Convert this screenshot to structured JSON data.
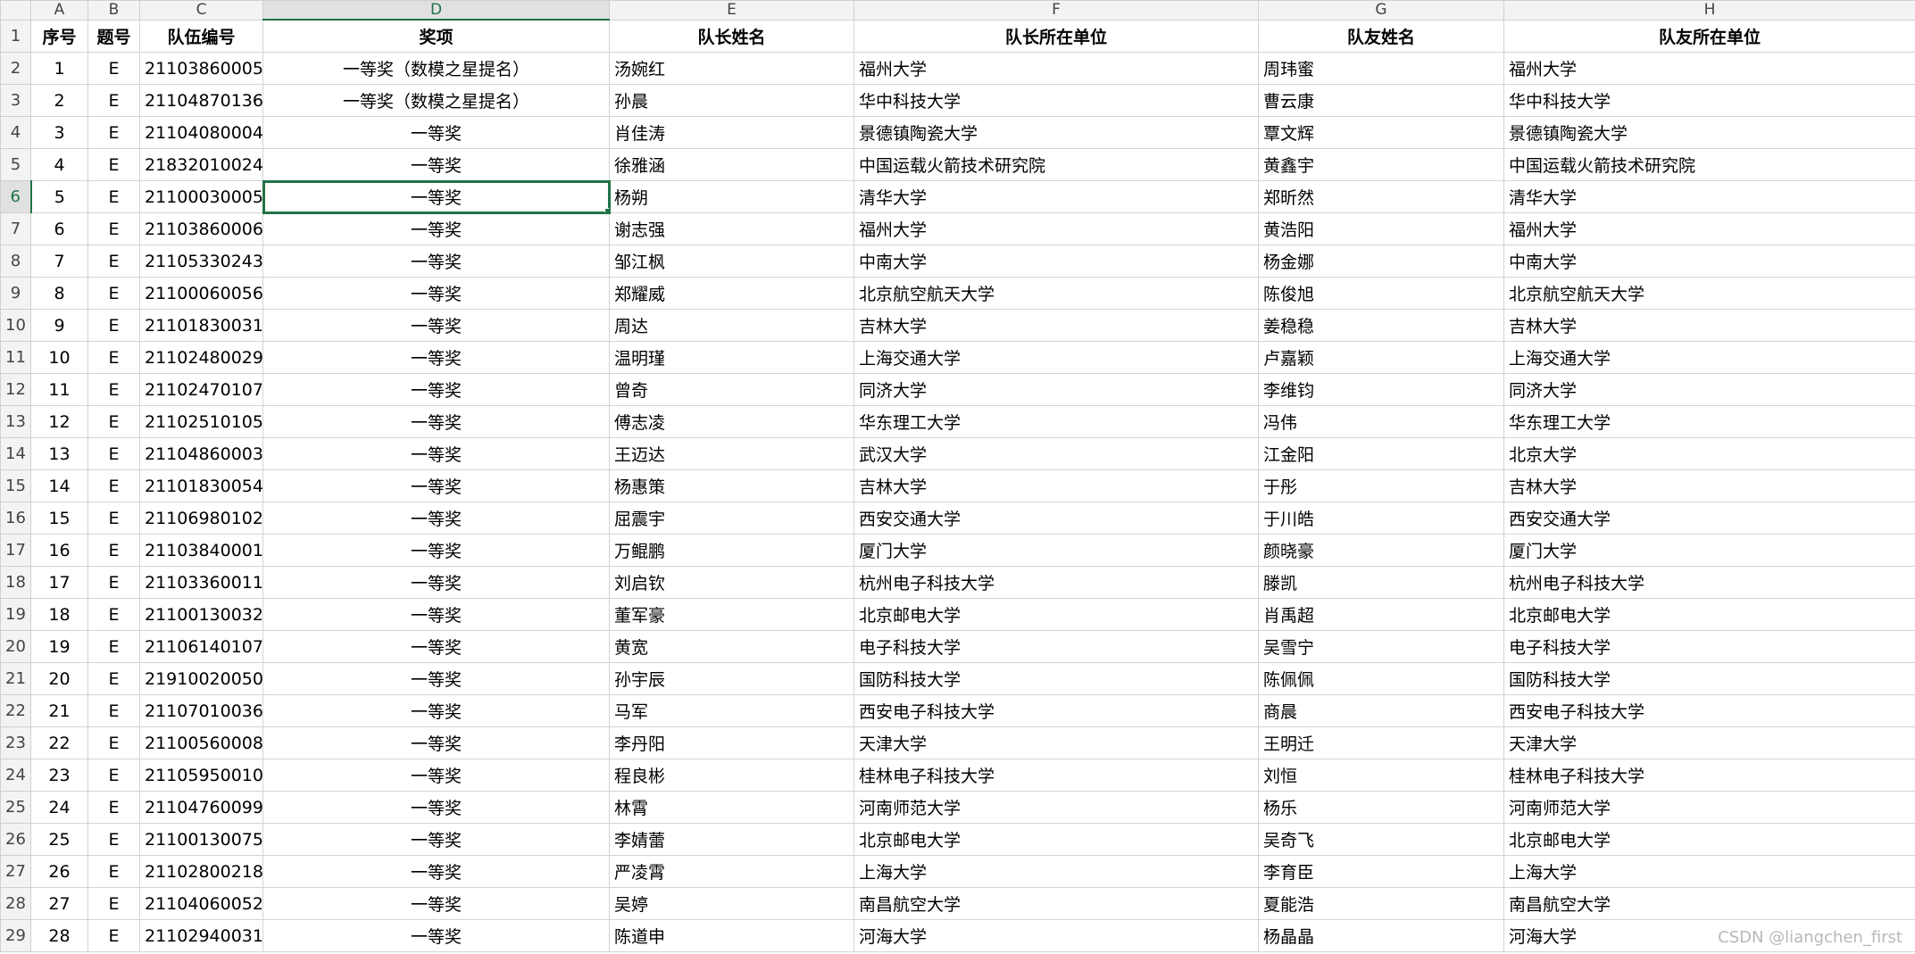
{
  "columns": [
    "A",
    "B",
    "C",
    "D",
    "E",
    "F",
    "G",
    "H"
  ],
  "selected_column": "D",
  "selected_row": 6,
  "header": [
    "序号",
    "题号",
    "队伍编号",
    "奖项",
    "队长姓名",
    "队长所在单位",
    "队友姓名",
    "队友所在单位"
  ],
  "rows": [
    [
      "1",
      "E",
      "21103860005",
      "一等奖（数模之星提名）",
      "汤婉红",
      "福州大学",
      "周玮蜜",
      "福州大学"
    ],
    [
      "2",
      "E",
      "21104870136",
      "一等奖（数模之星提名）",
      "孙晨",
      "华中科技大学",
      "曹云康",
      "华中科技大学"
    ],
    [
      "3",
      "E",
      "21104080004",
      "一等奖",
      "肖佳涛",
      "景德镇陶瓷大学",
      "覃文辉",
      "景德镇陶瓷大学"
    ],
    [
      "4",
      "E",
      "21832010024",
      "一等奖",
      "徐雅涵",
      "中国运载火箭技术研究院",
      "黄鑫宇",
      "中国运载火箭技术研究院"
    ],
    [
      "5",
      "E",
      "21100030005",
      "一等奖",
      "杨朔",
      "清华大学",
      "郑昕然",
      "清华大学"
    ],
    [
      "6",
      "E",
      "21103860006",
      "一等奖",
      "谢志强",
      "福州大学",
      "黄浩阳",
      "福州大学"
    ],
    [
      "7",
      "E",
      "21105330243",
      "一等奖",
      "邹江枫",
      "中南大学",
      "杨金娜",
      "中南大学"
    ],
    [
      "8",
      "E",
      "21100060056",
      "一等奖",
      "郑耀威",
      "北京航空航天大学",
      "陈俊旭",
      "北京航空航天大学"
    ],
    [
      "9",
      "E",
      "21101830031",
      "一等奖",
      "周达",
      "吉林大学",
      "姜稳稳",
      "吉林大学"
    ],
    [
      "10",
      "E",
      "21102480029",
      "一等奖",
      "温明瑾",
      "上海交通大学",
      "卢嘉颖",
      "上海交通大学"
    ],
    [
      "11",
      "E",
      "21102470107",
      "一等奖",
      "曾奇",
      "同济大学",
      "李维钧",
      "同济大学"
    ],
    [
      "12",
      "E",
      "21102510105",
      "一等奖",
      "傅志凌",
      "华东理工大学",
      "冯伟",
      "华东理工大学"
    ],
    [
      "13",
      "E",
      "21104860003",
      "一等奖",
      "王迈达",
      "武汉大学",
      "江金阳",
      "北京大学"
    ],
    [
      "14",
      "E",
      "21101830054",
      "一等奖",
      "杨惠策",
      "吉林大学",
      "于彤",
      "吉林大学"
    ],
    [
      "15",
      "E",
      "21106980102",
      "一等奖",
      "屈震宇",
      "西安交通大学",
      "于川皓",
      "西安交通大学"
    ],
    [
      "16",
      "E",
      "21103840001",
      "一等奖",
      "万鲲鹏",
      "厦门大学",
      "颜晓豪",
      "厦门大学"
    ],
    [
      "17",
      "E",
      "21103360011",
      "一等奖",
      "刘启钦",
      "杭州电子科技大学",
      "滕凯",
      "杭州电子科技大学"
    ],
    [
      "18",
      "E",
      "21100130032",
      "一等奖",
      "董军豪",
      "北京邮电大学",
      "肖禹超",
      "北京邮电大学"
    ],
    [
      "19",
      "E",
      "21106140107",
      "一等奖",
      "黄宽",
      "电子科技大学",
      "吴雪宁",
      "电子科技大学"
    ],
    [
      "20",
      "E",
      "21910020050",
      "一等奖",
      "孙宇辰",
      "国防科技大学",
      "陈佩佩",
      "国防科技大学"
    ],
    [
      "21",
      "E",
      "21107010036",
      "一等奖",
      "马军",
      "西安电子科技大学",
      "商晨",
      "西安电子科技大学"
    ],
    [
      "22",
      "E",
      "21100560008",
      "一等奖",
      "李丹阳",
      "天津大学",
      "王明迁",
      "天津大学"
    ],
    [
      "23",
      "E",
      "21105950010",
      "一等奖",
      "程良彬",
      "桂林电子科技大学",
      "刘恒",
      "桂林电子科技大学"
    ],
    [
      "24",
      "E",
      "21104760099",
      "一等奖",
      "林霄",
      "河南师范大学",
      "杨乐",
      "河南师范大学"
    ],
    [
      "25",
      "E",
      "21100130075",
      "一等奖",
      "李婧蕾",
      "北京邮电大学",
      "吴奇飞",
      "北京邮电大学"
    ],
    [
      "26",
      "E",
      "21102800218",
      "一等奖",
      "严凌霄",
      "上海大学",
      "李育臣",
      "上海大学"
    ],
    [
      "27",
      "E",
      "21104060052",
      "一等奖",
      "吴婷",
      "南昌航空大学",
      "夏能浩",
      "南昌航空大学"
    ],
    [
      "28",
      "E",
      "21102940031",
      "一等奖",
      "陈道申",
      "河海大学",
      "杨晶晶",
      "河海大学"
    ]
  ],
  "watermark": "CSDN @liangchen_first"
}
